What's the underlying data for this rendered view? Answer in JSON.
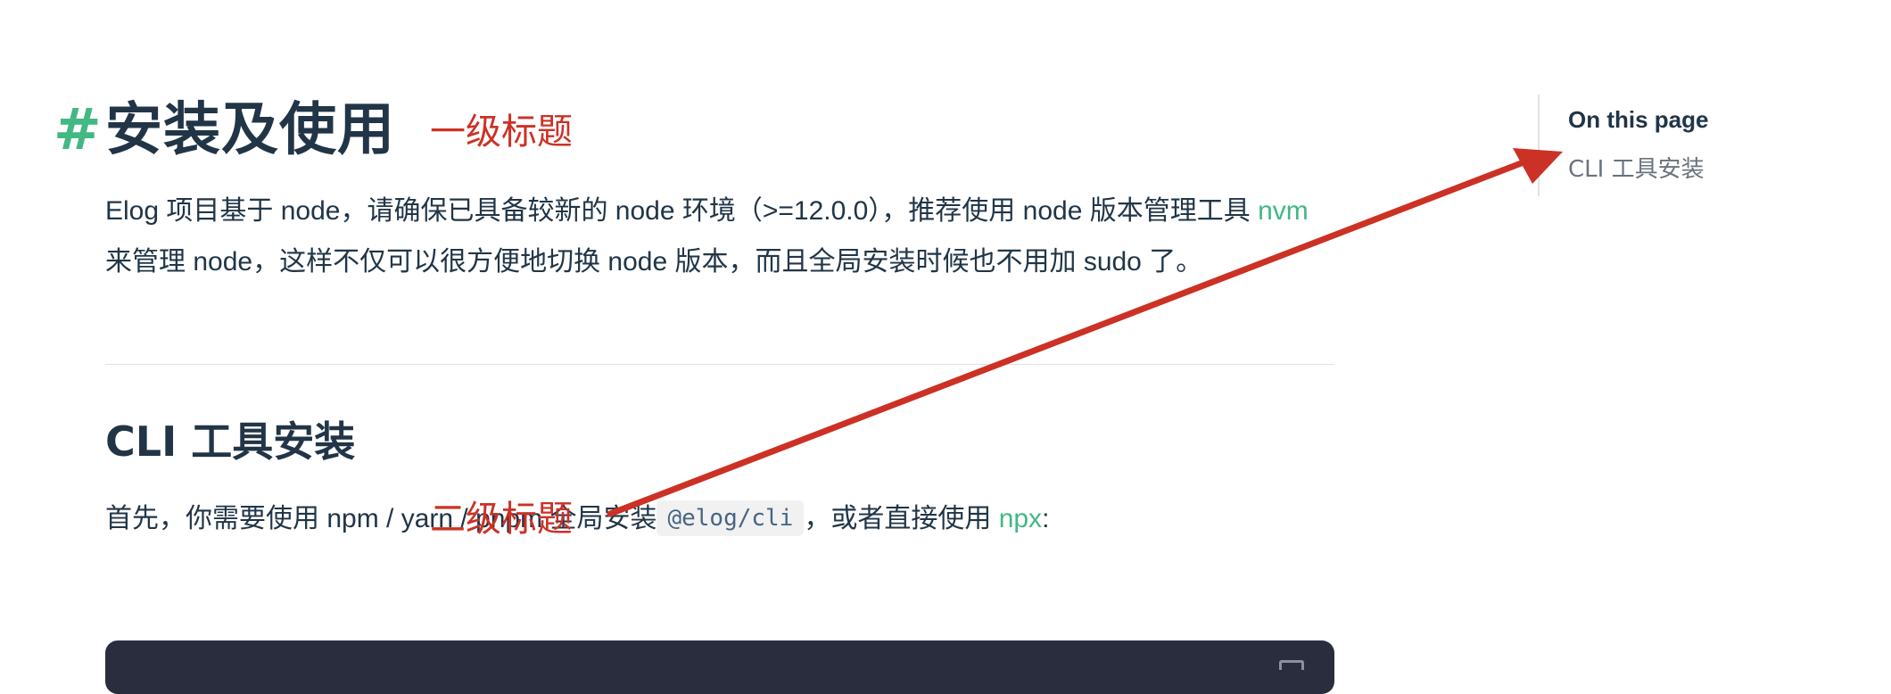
{
  "heading": {
    "anchor": "#",
    "title": "安装及使用"
  },
  "intro": {
    "text_before_link": "Elog 项目基于 node，请确保已具备较新的 node 环境（>=12.0.0），推荐使用 node 版本管理工具 ",
    "link": "nvm",
    "text_after_link": " 来管理 node，这样不仅可以很方便地切换 node 版本，而且全局安装时候也不用加 sudo 了。"
  },
  "section": {
    "title": "CLI 工具安装",
    "text_before_code": "首先，你需要使用 npm / yarn / pnpm 全局安装",
    "code": "@elog/cli",
    "text_middle": "，或者直接使用 ",
    "link": "npx",
    "text_after": ":"
  },
  "annotations": {
    "h1_label": "一级标题",
    "h2_label": "二级标题",
    "color": "#cc3125"
  },
  "toc": {
    "title": "On this page",
    "items": [
      {
        "label": "CLI 工具安装"
      }
    ]
  },
  "theme": {
    "accent": "#42b883",
    "text": "#213547",
    "code_block_bg": "#292d3e"
  }
}
